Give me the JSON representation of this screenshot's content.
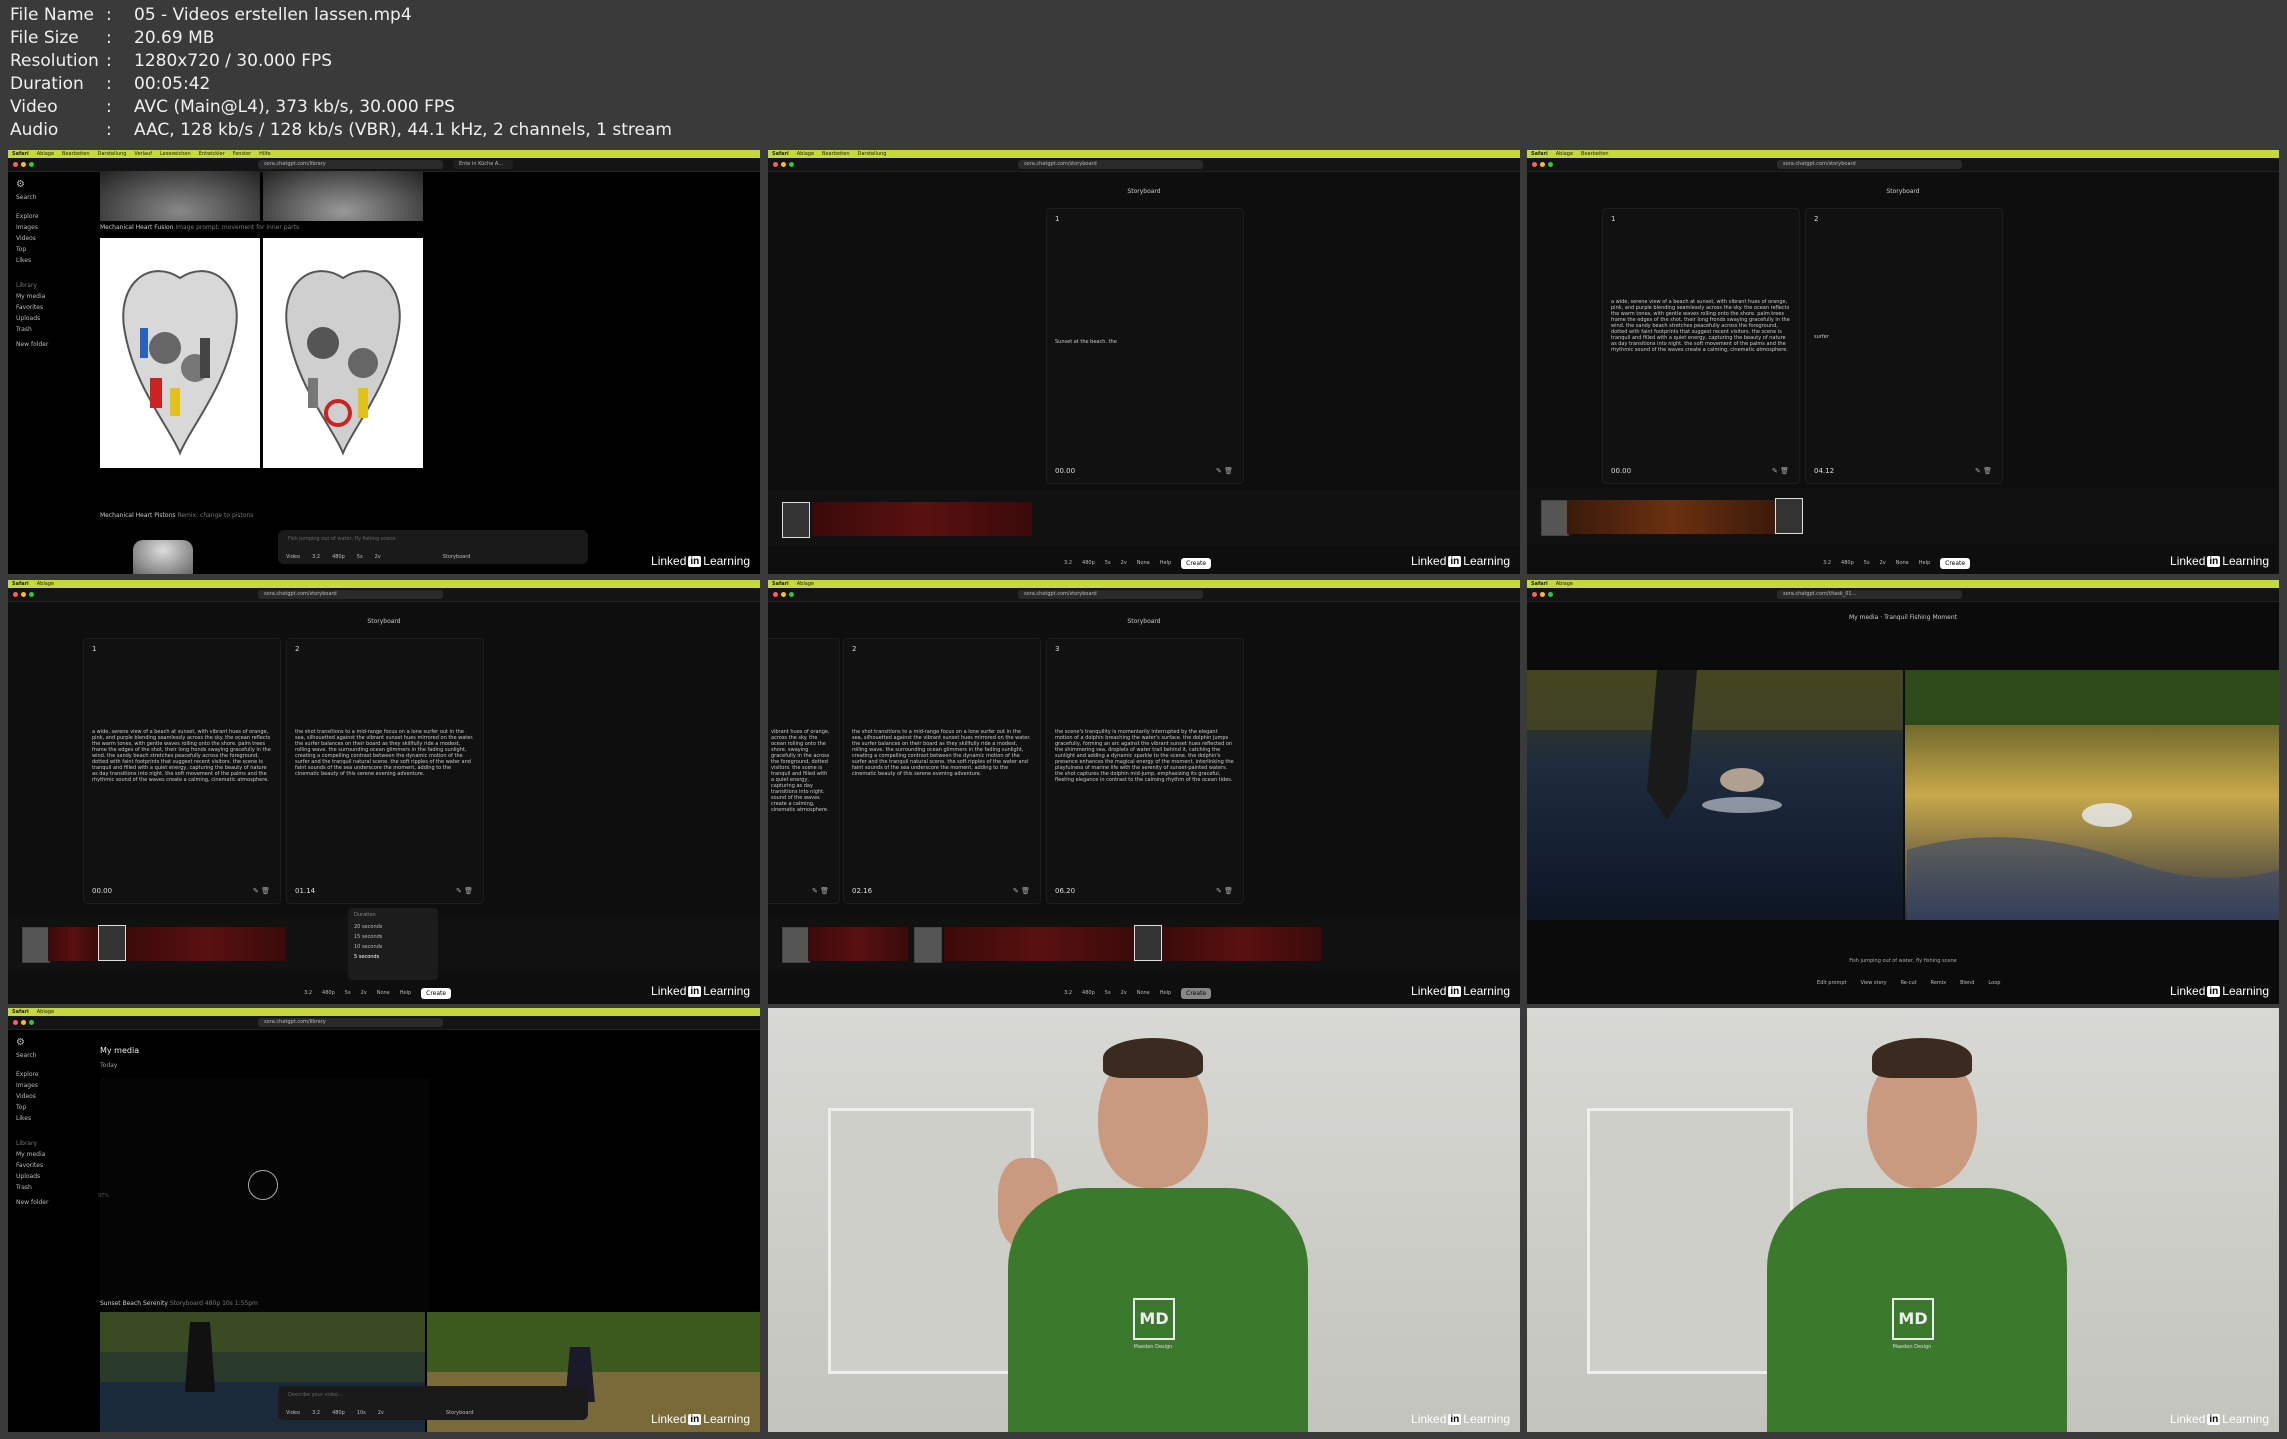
{
  "meta": {
    "rows": [
      {
        "key": "File Name",
        "value": "05 - Videos erstellen lassen.mp4"
      },
      {
        "key": "File Size",
        "value": "20.69 MB"
      },
      {
        "key": "Resolution",
        "value": "1280x720 / 30.000 FPS"
      },
      {
        "key": "Duration",
        "value": "00:05:42"
      },
      {
        "key": "Video",
        "value": "AVC (Main@L4), 373 kb/s, 30.000 FPS"
      },
      {
        "key": "Audio",
        "value": "AAC, 128 kb/s / 128 kb/s (VBR), 44.1 kHz, 2 channels, 1 stream"
      }
    ]
  },
  "common": {
    "menubar": [
      "Safari",
      "Ablage",
      "Bearbeiten",
      "Darstellung",
      "Verlauf",
      "Lesezeichen",
      "Entwickler",
      "Fenster",
      "Hilfe"
    ],
    "tab_label": "Ente in Küche A...",
    "linkedin_pre": "Linked",
    "linkedin_in": "in",
    "linkedin_post": "Learning",
    "storyboard_title": "Storyboard"
  },
  "tile1": {
    "url": "sora.chatgpt.com/library",
    "sidebar": [
      "Search",
      "Explore",
      "Images",
      "Videos",
      "Top",
      "Likes",
      "Library",
      "My media",
      "Favorites",
      "Uploads",
      "Trash",
      "New folder"
    ],
    "caption1": "Mechanical Heart Fusion",
    "caption1_meta": "Image prompt: movement for inner parts",
    "caption2": "Mechanical Heart Pistons",
    "caption2_meta": "Remix: change to pistons",
    "prompt_placeholder": "Fish jumping out of water, fly fishing scene",
    "bottom_tools": [
      "Video",
      "3:2",
      "480p",
      "5s",
      "2v",
      "Storyboard"
    ]
  },
  "tile2": {
    "url": "sora.chatgpt.com/storyboard",
    "card": {
      "num": "1",
      "text": "Sunset at the beach. the",
      "time": "00.00"
    },
    "tools": [
      "3:2",
      "480p",
      "5s",
      "2v",
      "None",
      "Help",
      "Create"
    ]
  },
  "tile3": {
    "url": "sora.chatgpt.com/storyboard",
    "cards": [
      {
        "num": "1",
        "text": "a wide, serene view of a beach at sunset, with vibrant hues of orange, pink, and purple blending seamlessly across the sky. the ocean reflects the warm tones, with gentle waves rolling onto the shore. palm trees frame the edges of the shot, their long fronds swaying gracefully in the wind. the sandy beach stretches peacefully across the foreground, dotted with faint footprints that suggest recent visitors. the scene is tranquil and filled with a quiet energy, capturing the beauty of nature as day transitions into night. the soft movement of the palms and the rhythmic sound of the waves create a calming, cinematic atmosphere.",
        "time": "00.00"
      },
      {
        "num": "2",
        "text": "surfer",
        "time": "04.12"
      }
    ]
  },
  "tile4": {
    "url": "sora.chatgpt.com/storyboard",
    "cards": [
      {
        "num": "1",
        "text": "a wide, serene view of a beach at sunset, with vibrant hues of orange, pink, and purple blending seamlessly across the sky. the ocean reflects the warm tones, with gentle waves rolling onto the shore. palm trees frame the edges of the shot, their long fronds swaying gracefully in the wind. the sandy beach stretches peacefully across the foreground, dotted with faint footprints that suggest recent visitors. the scene is tranquil and filled with a quiet energy, capturing the beauty of nature as day transitions into night. the soft movement of the palms and the rhythmic sound of the waves create a calming, cinematic atmosphere.",
        "time": "00.00"
      },
      {
        "num": "2",
        "text": "the shot transitions to a mid-range focus on a lone surfer out in the sea, silhouetted against the vibrant sunset hues mirrored on the water. the surfer balances on their board as they skillfully ride a modest, rolling wave. the surrounding ocean glimmers in the fading sunlight, creating a compelling contrast between the dynamic motion of the surfer and the tranquil natural scene. the soft ripples of the water and faint sounds of the sea underscore the moment, adding to the cinematic beauty of this serene evening adventure.",
        "time": "01.14"
      }
    ],
    "duration_menu": {
      "title": "Duration",
      "options": [
        "20 seconds",
        "15 seconds",
        "10 seconds",
        "5 seconds"
      ]
    }
  },
  "tile5": {
    "url": "sora.chatgpt.com/storyboard",
    "cards": [
      {
        "num": "",
        "text": "vibrant hues of orange, across the sky. the ocean rolling onto the shore. swaying gracefully in the across the foreground, dotted visitors. the scene is tranquil and filled with a quiet energy, capturing as day transitions into night. sound of the waves create a calming, cinematic atmosphere.",
        "time": ""
      },
      {
        "num": "2",
        "text": "the shot transitions to a mid-range focus on a lone surfer out in the sea, silhouetted against the vibrant sunset hues mirrored on the water. the surfer balances on their board as they skillfully ride a modest, rolling wave. the surrounding ocean glimmers in the fading sunlight, creating a compelling contrast between the dynamic motion of the surfer and the tranquil natural scene. the soft ripples of the water and faint sounds of the sea underscore the moment, adding to the cinematic beauty of this serene evening adventure.",
        "time": "02.16"
      },
      {
        "num": "3",
        "text": "the scene's tranquility is momentarily interrupted by the elegant motion of a dolphin breaching the water's surface. the dolphin jumps gracefully, forming an arc against the vibrant sunset hues reflected on the shimmering sea. droplets of water trail behind it, catching the sunlight and adding a dynamic sparkle to the scene. the dolphin's presence enhances the magical energy of the moment, interlinking the playfulness of marine life with the serenity of sunset-painted waters. the shot captures the dolphin mid-jump, emphasizing its graceful, fleeting elegance in contrast to the calming rhythm of the ocean tides.",
        "time": "06.20"
      }
    ]
  },
  "tile6": {
    "url": "sora.chatgpt.com/t/task_01...",
    "breadcrumb": "My media",
    "title": "Tranquil Fishing Moment",
    "prompt": "Fish jumping out of water, fly fishing scene",
    "tools": [
      "Edit prompt",
      "View story",
      "Re-cut",
      "Remix",
      "Blend",
      "Loop"
    ]
  },
  "tile7": {
    "url": "sora.chatgpt.com/library",
    "heading": "My media",
    "subheading": "Today",
    "progress": "97%",
    "caption": "Sunset Beach Serenity",
    "caption_meta": "Storyboard  480p  10s  1:55pm",
    "prompt_placeholder": "Describe your video...",
    "bottom_tools": [
      "Video",
      "3:2",
      "480p",
      "10s",
      "2v",
      "Storyboard"
    ]
  },
  "tile8": {
    "shirt_logo": "MD",
    "shirt_text": "Maeden Design"
  },
  "colors": {
    "menubar": "#c6d93b",
    "background": "#3a3a3a",
    "shirt": "#3b7a2c"
  }
}
